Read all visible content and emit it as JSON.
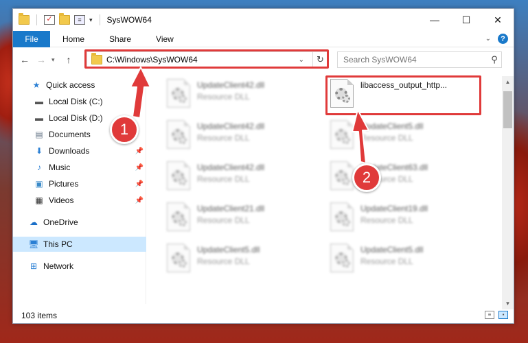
{
  "window": {
    "title": "SysWOW64",
    "controls": {
      "minimize": "—",
      "maximize": "☐",
      "close": "✕"
    }
  },
  "ribbon": {
    "file": "File",
    "tabs": [
      "Home",
      "Share",
      "View"
    ]
  },
  "nav": {
    "back": "←",
    "forward": "→",
    "recent": "▾",
    "up": "↑",
    "address": "C:\\Windows\\SysWOW64",
    "refresh": "↻",
    "search_placeholder": "Search SysWOW64"
  },
  "sidebar": {
    "items": [
      {
        "label": "Quick access",
        "icon": "star-icon"
      },
      {
        "label": "Local Disk (C:)",
        "icon": "drive-icon"
      },
      {
        "label": "Local Disk (D:)",
        "icon": "drive-icon"
      },
      {
        "label": "Documents",
        "icon": "documents-icon"
      },
      {
        "label": "Downloads",
        "icon": "download-icon"
      },
      {
        "label": "Music",
        "icon": "music-icon"
      },
      {
        "label": "Pictures",
        "icon": "pictures-icon"
      },
      {
        "label": "Videos",
        "icon": "videos-icon"
      },
      {
        "label": "OneDrive",
        "icon": "cloud-icon"
      },
      {
        "label": "This PC",
        "icon": "computer-icon"
      },
      {
        "label": "Network",
        "icon": "network-icon"
      }
    ]
  },
  "files": [
    {
      "name": "UpdateClient42.dll",
      "type": "Resource DLL"
    },
    {
      "name": "libaccess_output_http...",
      "type": ""
    },
    {
      "name": "UpdateClient42.dll",
      "type": "Resource DLL"
    },
    {
      "name": "UpdateClient5.dll",
      "type": "Resource DLL"
    },
    {
      "name": "UpdateClient42.dll",
      "type": "Resource DLL"
    },
    {
      "name": "UpdateClient63.dll",
      "type": "Resource DLL"
    },
    {
      "name": "UpdateClient21.dll",
      "type": "Resource DLL"
    },
    {
      "name": "UpdateClient19.dll",
      "type": "Resource DLL"
    },
    {
      "name": "UpdateClient5.dll",
      "type": "Resource DLL"
    },
    {
      "name": "UpdateClient5.dll",
      "type": "Resource DLL"
    }
  ],
  "status": {
    "count": "103 items"
  },
  "annotations": {
    "step1": "1",
    "step2": "2",
    "color": "#e03a3a"
  }
}
